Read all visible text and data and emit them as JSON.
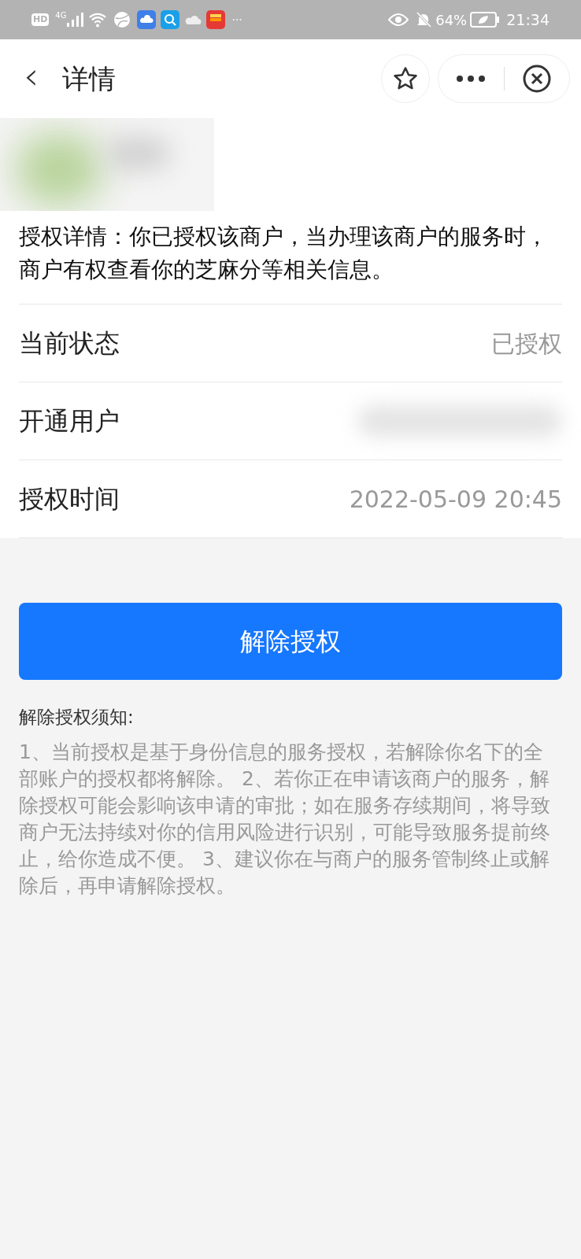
{
  "status_bar": {
    "badge": "HD",
    "network": "4G",
    "more": "···",
    "battery": "64%",
    "time": "21:34"
  },
  "header": {
    "back": "‹",
    "title": "详情"
  },
  "description": "授权详情：你已授权该商户，当办理该商户的服务时，商户有权查看你的芝麻分等相关信息。",
  "rows": [
    {
      "label": "当前状态",
      "kind": "text",
      "value": "已授权"
    },
    {
      "label": "开通用户",
      "kind": "blurred"
    },
    {
      "label": "授权时间",
      "kind": "text",
      "value": "2022-05-09 20:45"
    }
  ],
  "button": "解除授权",
  "notice": {
    "title": "解除授权须知:",
    "body": "1、当前授权是基于身份信息的服务授权，若解除你名下的全部账户的授权都将解除。 2、若你正在申请该商户的服务，解除授权可能会影响该申请的审批；如在服务存续期间，将导致商户无法持续对你的信用风险进行识别，可能导致服务提前终止，给你造成不便。 3、建议你在与商户的服务管制终止或解除后，再申请解除授权。"
  }
}
